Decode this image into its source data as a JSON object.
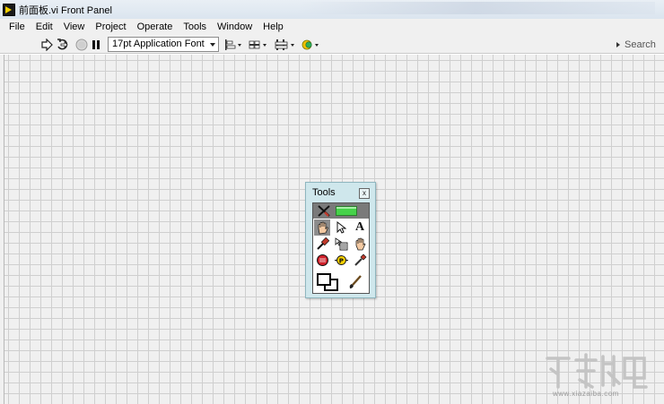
{
  "window": {
    "title": "前面板.vi Front Panel"
  },
  "menu": {
    "items": [
      "File",
      "Edit",
      "View",
      "Project",
      "Operate",
      "Tools",
      "Window",
      "Help"
    ]
  },
  "toolbar": {
    "run_icon": "run-arrow-icon",
    "run_continuous_icon": "run-continuously-icon",
    "abort_icon": "abort-icon",
    "pause_icon": "pause-icon",
    "font_select_value": "17pt Application Font",
    "align_icon": "align-objects-icon",
    "distribute_icon": "distribute-objects-icon",
    "resize_icon": "resize-objects-icon",
    "reorder_icon": "reorder-icon",
    "search_label": "Search"
  },
  "tools_palette": {
    "title": "Tools",
    "close_glyph": "x",
    "tools": [
      "automatic-tool-selection",
      "operate-value-tool",
      "position-size-select-tool",
      "edit-text-tool",
      "connect-wire-tool",
      "object-shortcut-menu-tool",
      "scroll-window-tool",
      "set-clear-breakpoint-tool",
      "probe-data-tool",
      "get-color-tool",
      "set-color-tool"
    ],
    "text_tool_glyph": "A"
  },
  "watermark": {
    "text": "www.xiazaiba.com"
  },
  "colors": {
    "canvas_bg": "#f0f0f0",
    "grid_line": "#cfcfcf",
    "palette_bg": "#cfe7ec",
    "led_green": "#46d24a"
  }
}
